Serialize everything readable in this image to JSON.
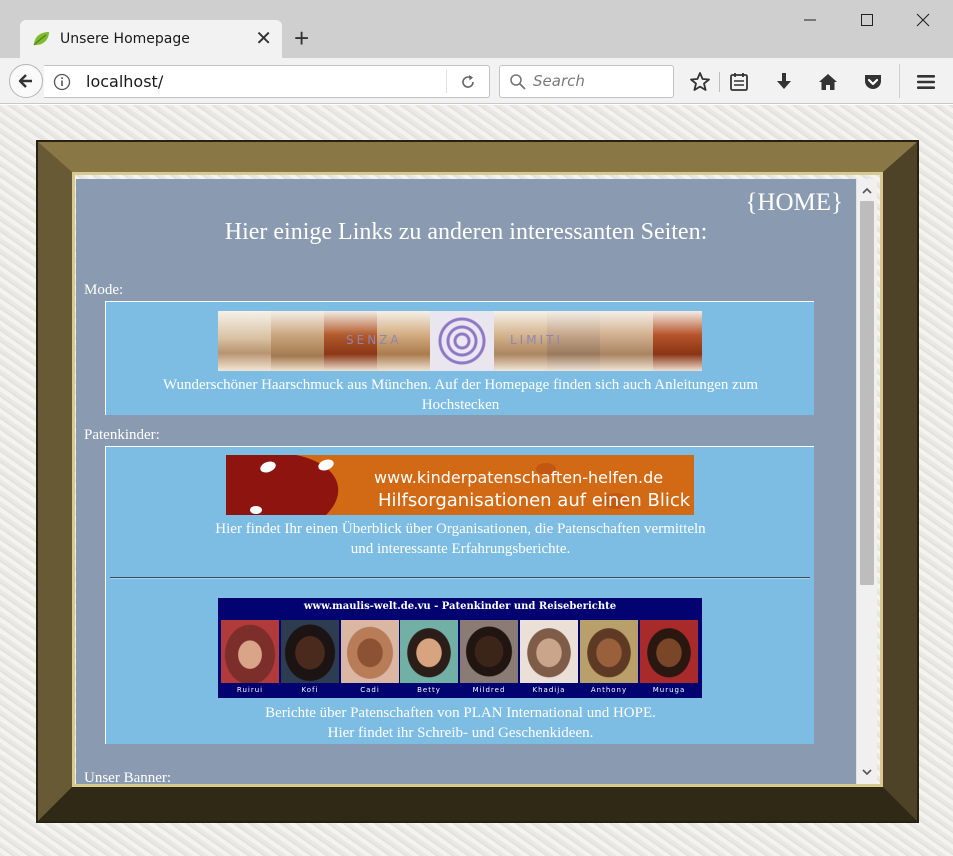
{
  "browser": {
    "tab_title": "Unsere Homepage",
    "url": "localhost/",
    "search_placeholder": "Search",
    "icons": [
      "leaf-favicon-icon",
      "close-icon",
      "plus-icon",
      "minimize-icon",
      "maximize-icon",
      "window-close-icon",
      "back-arrow-icon",
      "info-icon",
      "reload-icon",
      "search-icon",
      "star-icon",
      "reading-list-icon",
      "download-icon",
      "home-icon",
      "pocket-icon",
      "menu-icon"
    ]
  },
  "page": {
    "home_link": "{HOME}",
    "heading": "Hier einige Links zu anderen interessanten Seiten:",
    "sections": [
      {
        "label": "Mode:",
        "items": [
          {
            "banner_text": [
              "SENZA",
              "LIMITI"
            ],
            "caption_lines": [
              "Wunderschöner Haarschmuck aus München. Auf der Homepage finden sich auch Anleitungen zum",
              "Hochstecken"
            ]
          }
        ]
      },
      {
        "label": "Patenkinder:",
        "items": [
          {
            "banner_text": [
              "www.kinderpatenschaften-helfen.de",
              "Hilfsorganisationen auf einen Blick"
            ],
            "caption_lines": [
              "Hier findet Ihr einen Überblick über Organisationen, die Patenschaften vermitteln",
              "und interessante Erfahrungsberichte."
            ]
          },
          {
            "banner_title": "www.maulis-welt.de.vu - Patenkinder und Reiseberichte",
            "children": [
              "Ruirui",
              "Kofi",
              "Cadi",
              "Betty",
              "Mildred",
              "Khadija",
              "Anthony",
              "Muruga"
            ],
            "caption_lines": [
              "Berichte über Patenschaften von PLAN International und HOPE.",
              "Hier findet ihr Schreib- und Geschenkideen."
            ]
          }
        ]
      },
      {
        "label": "Unser Banner:"
      }
    ]
  },
  "colors": {
    "viewport_bg": "#8a9bb1",
    "box_bg": "#7dbde4",
    "frame_gold": "#8a7746",
    "kinder_orange": "#cf6612",
    "maulis_navy": "#020270"
  }
}
